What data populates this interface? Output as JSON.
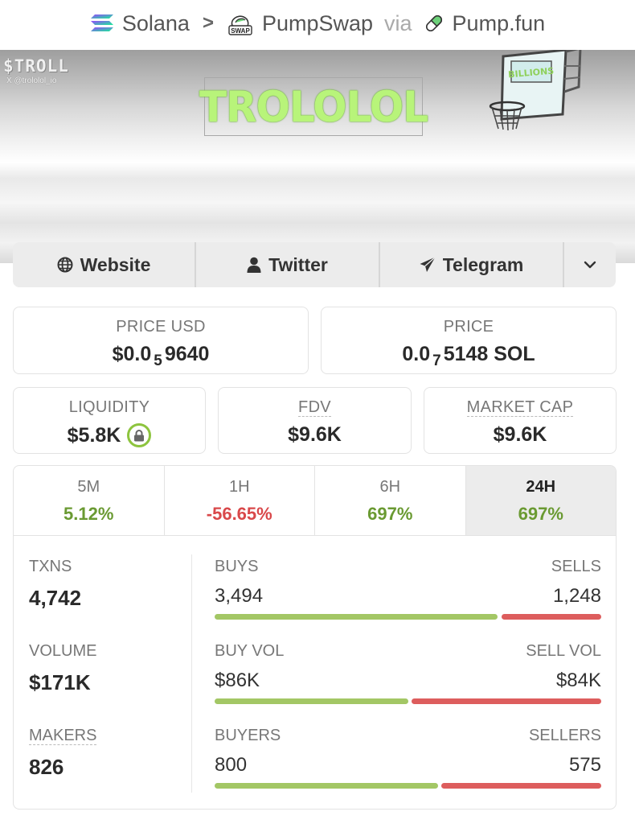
{
  "breadcrumb": {
    "chain": "Solana",
    "separator": ">",
    "dex": "PumpSwap",
    "via": "via",
    "launchpad": "Pump.fun",
    "dex_icon_text": "SWAP"
  },
  "banner": {
    "ticker": "$TROLL",
    "handle": "X @trololol_io",
    "title": "TROLOLOL",
    "hoop_text": "BILLIONS"
  },
  "links": {
    "website": "Website",
    "twitter": "Twitter",
    "telegram": "Telegram"
  },
  "price_usd": {
    "label": "PRICE USD",
    "prefix": "$0.0",
    "zeros": "5",
    "digits": "9640"
  },
  "price_sol": {
    "label": "PRICE",
    "prefix": "0.0",
    "zeros": "7",
    "digits": "5148 SOL"
  },
  "liquidity": {
    "label": "LIQUIDITY",
    "value": "$5.8K"
  },
  "fdv": {
    "label": "FDV",
    "value": "$9.6K"
  },
  "market_cap": {
    "label": "MARKET CAP",
    "value": "$9.6K"
  },
  "periods": [
    {
      "label": "5M",
      "value": "5.12%",
      "trend": "up"
    },
    {
      "label": "1H",
      "value": "-56.65%",
      "trend": "down"
    },
    {
      "label": "6H",
      "value": "697%",
      "trend": "up"
    },
    {
      "label": "24H",
      "value": "697%",
      "trend": "up",
      "selected": true
    }
  ],
  "metrics": {
    "txns": {
      "label": "TXNS",
      "value": "4,742"
    },
    "volume": {
      "label": "VOLUME",
      "value": "$171K"
    },
    "makers": {
      "label": "MAKERS",
      "value": "826"
    }
  },
  "splits": {
    "txns": {
      "buy_label": "BUYS",
      "sell_label": "SELLS",
      "buy_value": "3,494",
      "sell_value": "1,248",
      "buy_share": 0.737
    },
    "volume": {
      "buy_label": "BUY VOL",
      "sell_label": "SELL VOL",
      "buy_value": "$86K",
      "sell_value": "$84K",
      "buy_share": 0.506
    },
    "makers": {
      "buy_label": "BUYERS",
      "sell_label": "SELLERS",
      "buy_value": "800",
      "sell_value": "575",
      "buy_share": 0.582
    }
  },
  "colors": {
    "positive": "#6a9a32",
    "negative": "#d9484a",
    "buy_bar": "#a3c765",
    "sell_bar": "#dd5d5d",
    "title_glow": "#b8f47a"
  }
}
